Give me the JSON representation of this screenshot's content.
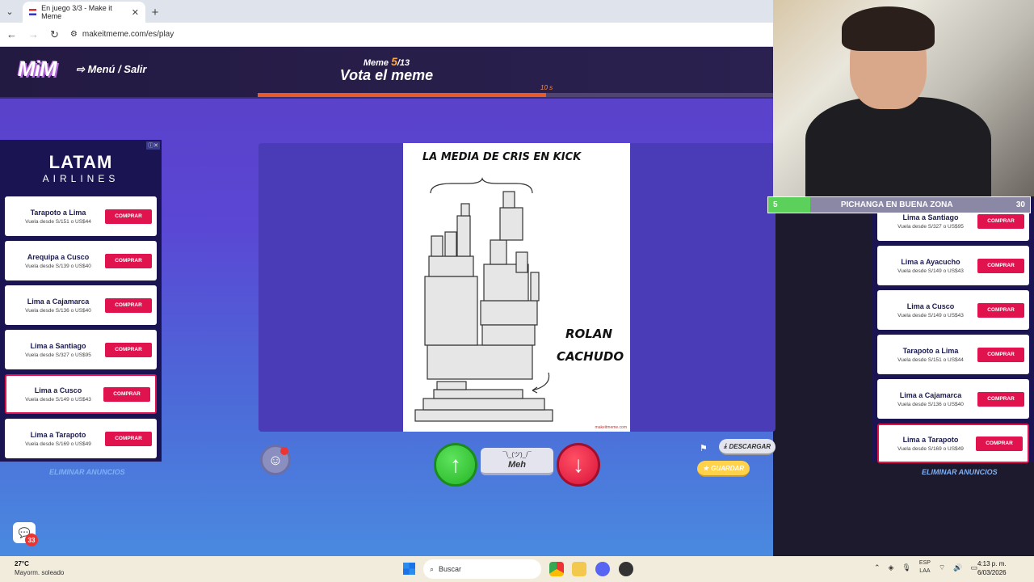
{
  "browser": {
    "tab_title": "En juego 3/3 - Make it Meme",
    "url": "makeitmeme.com/es/play"
  },
  "game": {
    "logo": "MiM",
    "menu_label": "Menú / Salir",
    "meme_prefix": "Meme",
    "meme_current": "5",
    "meme_total": "/13",
    "title": "Vota el meme",
    "timer": "10 s",
    "progress_fraction": 0.56,
    "meme_top_text": "LA MEDIA DE CRIS EN KICK",
    "meme_label_line1": "ROLAN",
    "meme_label_line2": "CACHUDO",
    "meme_watermark": "makeitmeme.com",
    "meh_face": "¯\\_(ツ)_/¯",
    "meh_label": "Meh",
    "upvote_icon": "↑",
    "downvote_icon": "↓",
    "download_label": "DESCARGAR",
    "save_label": "GUARDAR",
    "chat_count": "33"
  },
  "ad_left": {
    "brand": "LATAM",
    "brand_sub": "AIRLINES",
    "items": [
      {
        "route": "Tarapoto a Lima",
        "price": "Vuela desde S/151 o US$44",
        "cta": "COMPRAR"
      },
      {
        "route": "Arequipa a Cusco",
        "price": "Vuela desde S/139 o US$40",
        "cta": "COMPRAR"
      },
      {
        "route": "Lima a Cajamarca",
        "price": "Vuela desde S/136 o US$40",
        "cta": "COMPRAR"
      },
      {
        "route": "Lima a Santiago",
        "price": "Vuela desde S/327 o US$95",
        "cta": "COMPRAR"
      },
      {
        "route": "Lima a Cusco",
        "price": "Vuela desde S/149 o US$43",
        "cta": "COMPRAR"
      },
      {
        "route": "Lima a Tarapoto",
        "price": "Vuela desde S/169 o US$49",
        "cta": "COMPRAR"
      }
    ],
    "remove_label": "ELIMINAR ANUNCIOS"
  },
  "ad_right": {
    "items": [
      {
        "route": "Lima a Santiago",
        "price": "Vuela desde S/327 o US$95",
        "cta": "COMPRAR"
      },
      {
        "route": "Lima a Ayacucho",
        "price": "Vuela desde S/149 o US$43",
        "cta": "COMPRAR"
      },
      {
        "route": "Lima a Cusco",
        "price": "Vuela desde S/149 o US$43",
        "cta": "COMPRAR"
      },
      {
        "route": "Tarapoto a Lima",
        "price": "Vuela desde S/151 o US$44",
        "cta": "COMPRAR"
      },
      {
        "route": "Lima a Cajamarca",
        "price": "Vuela desde S/136 o US$40",
        "cta": "COMPRAR"
      },
      {
        "route": "Lima a Tarapoto",
        "price": "Vuela desde S/169 o US$49",
        "cta": "COMPRAR"
      }
    ],
    "remove_label": "ELIMINAR ANUNCIOS"
  },
  "stream_overlay": {
    "left_value": "5",
    "title": "PICHANGA EN BUENA ZONA",
    "right_value": "30"
  },
  "taskbar": {
    "temperature": "27°C",
    "weather": "Mayorm. soleado",
    "search_placeholder": "Buscar",
    "lang1": "ESP",
    "lang2": "LAA",
    "time": "4:13 p. m.",
    "date": "6/03/2026"
  }
}
